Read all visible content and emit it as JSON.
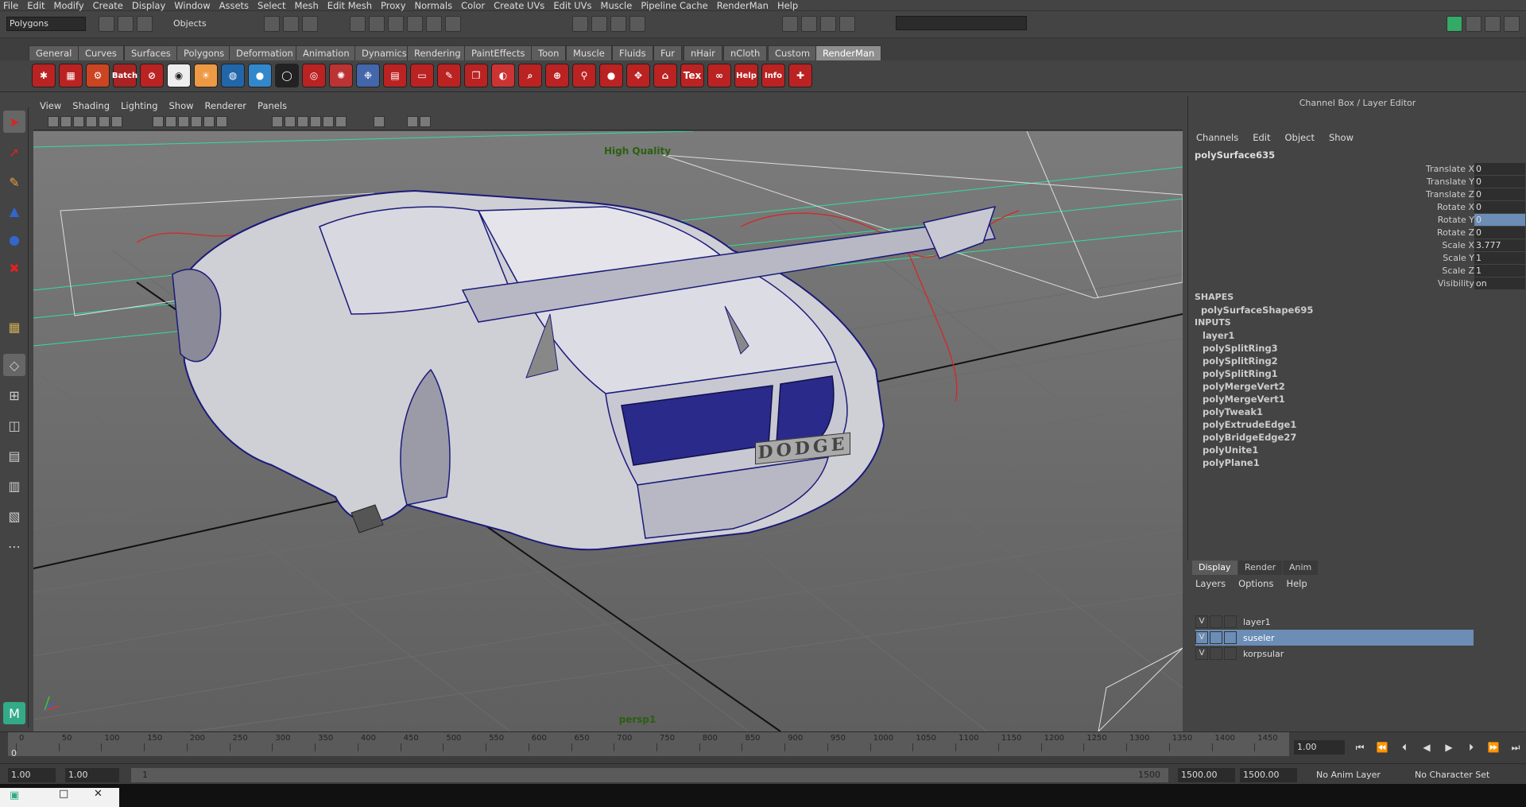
{
  "menubar": [
    "File",
    "Edit",
    "Modify",
    "Create",
    "Display",
    "Window",
    "Assets",
    "Select",
    "Mesh",
    "Edit Mesh",
    "Proxy",
    "Normals",
    "Color",
    "Create UVs",
    "Edit UVs",
    "Muscle",
    "Pipeline Cache",
    "RenderMan",
    "Help"
  ],
  "status": {
    "mode": "Polygons",
    "selection": "Objects"
  },
  "shelf_tabs": [
    "General",
    "Curves",
    "Surfaces",
    "Polygons",
    "Deformation",
    "Animation",
    "Dynamics",
    "Rendering",
    "PaintEffects",
    "Toon",
    "Muscle",
    "Fluids",
    "Fur",
    "nHair",
    "nCloth",
    "Custom",
    "RenderMan"
  ],
  "shelf_active": "RenderMan",
  "shelf_labels": {
    "batch": "Batch",
    "tex": "Tex",
    "help": "Help",
    "info": "Info"
  },
  "viewport": {
    "menu": [
      "View",
      "Shading",
      "Lighting",
      "Show",
      "Renderer",
      "Panels"
    ],
    "quality": "High Quality",
    "camera": "persp1",
    "plate": "DODGE"
  },
  "channelbox": {
    "title": "Channel Box / Layer Editor",
    "menu": [
      "Channels",
      "Edit",
      "Object",
      "Show"
    ],
    "object": "polySurface635",
    "attrs": [
      {
        "name": "Translate X",
        "value": "0"
      },
      {
        "name": "Translate Y",
        "value": "0"
      },
      {
        "name": "Translate Z",
        "value": "0"
      },
      {
        "name": "Rotate X",
        "value": "0"
      },
      {
        "name": "Rotate Y",
        "value": "0"
      },
      {
        "name": "Rotate Z",
        "value": "0"
      },
      {
        "name": "Scale X",
        "value": "3.777"
      },
      {
        "name": "Scale Y",
        "value": "1"
      },
      {
        "name": "Scale Z",
        "value": "1"
      },
      {
        "name": "Visibility",
        "value": "on"
      }
    ],
    "shapes_header": "SHAPES",
    "shape": "polySurfaceShape695",
    "inputs_header": "INPUTS",
    "inputs": [
      "layer1",
      "polySplitRing3",
      "polySplitRing2",
      "polySplitRing1",
      "polyMergeVert2",
      "polyMergeVert1",
      "polyTweak1",
      "polyExtrudeEdge1",
      "polyBridgeEdge27",
      "polyUnite1",
      "polyPlane1"
    ]
  },
  "layers": {
    "tabs": [
      "Display",
      "Render",
      "Anim"
    ],
    "menu": [
      "Layers",
      "Options",
      "Help"
    ],
    "rows": [
      {
        "v": "V",
        "name": "layer1"
      },
      {
        "v": "V",
        "name": "suseler"
      },
      {
        "v": "V",
        "name": "korpsular"
      }
    ]
  },
  "timeline": {
    "ticks": [
      "0",
      "50",
      "100",
      "150",
      "200",
      "250",
      "300",
      "350",
      "400",
      "450",
      "500",
      "550",
      "600",
      "650",
      "700",
      "750",
      "800",
      "850",
      "900",
      "950",
      "1000",
      "1050",
      "1100",
      "1150",
      "1200",
      "1250",
      "1300",
      "1350",
      "1400",
      "1450"
    ],
    "current_label": "0",
    "current_frame": "1.00"
  },
  "range": {
    "start": "1.00",
    "start2": "1.00",
    "slider_start": "1",
    "slider_end": "1500",
    "end": "1500.00",
    "end2": "1500.00",
    "anim_layer": "No Anim Layer",
    "char_set": "No Character Set"
  }
}
